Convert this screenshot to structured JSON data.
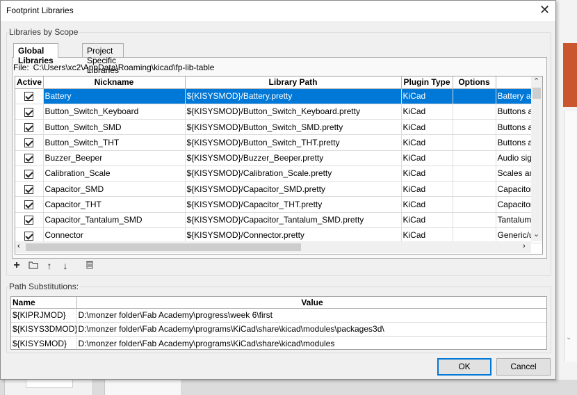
{
  "window": {
    "title": "Footprint Libraries",
    "close_glyph": "✕"
  },
  "scope_group": {
    "label": "Libraries by Scope",
    "tabs": [
      "Global Libraries",
      "Project Specific Libraries"
    ],
    "active_tab": "Global Libraries"
  },
  "file": {
    "label": "File:",
    "path": "C:\\Users\\xc2\\AppData\\Roaming\\kicad\\fp-lib-table"
  },
  "library_table": {
    "columns": [
      "Active",
      "Nickname",
      "Library Path",
      "Plugin Type",
      "Options",
      ""
    ],
    "selected_row": 0,
    "rows": [
      {
        "active": true,
        "nickname": "Battery",
        "path": "${KISYSMOD}/Battery.pretty",
        "plugin": "KiCad",
        "options": "",
        "description": "Battery ar"
      },
      {
        "active": true,
        "nickname": "Button_Switch_Keyboard",
        "path": "${KISYSMOD}/Button_Switch_Keyboard.pretty",
        "plugin": "KiCad",
        "options": "",
        "description": "Buttons a"
      },
      {
        "active": true,
        "nickname": "Button_Switch_SMD",
        "path": "${KISYSMOD}/Button_Switch_SMD.pretty",
        "plugin": "KiCad",
        "options": "",
        "description": "Buttons a"
      },
      {
        "active": true,
        "nickname": "Button_Switch_THT",
        "path": "${KISYSMOD}/Button_Switch_THT.pretty",
        "plugin": "KiCad",
        "options": "",
        "description": "Buttons a"
      },
      {
        "active": true,
        "nickname": "Buzzer_Beeper",
        "path": "${KISYSMOD}/Buzzer_Beeper.pretty",
        "plugin": "KiCad",
        "options": "",
        "description": "Audio sig"
      },
      {
        "active": true,
        "nickname": "Calibration_Scale",
        "path": "${KISYSMOD}/Calibration_Scale.pretty",
        "plugin": "KiCad",
        "options": "",
        "description": "Scales an"
      },
      {
        "active": true,
        "nickname": "Capacitor_SMD",
        "path": "${KISYSMOD}/Capacitor_SMD.pretty",
        "plugin": "KiCad",
        "options": "",
        "description": "Capacitor"
      },
      {
        "active": true,
        "nickname": "Capacitor_THT",
        "path": "${KISYSMOD}/Capacitor_THT.pretty",
        "plugin": "KiCad",
        "options": "",
        "description": "Capacitor"
      },
      {
        "active": true,
        "nickname": "Capacitor_Tantalum_SMD",
        "path": "${KISYSMOD}/Capacitor_Tantalum_SMD.pretty",
        "plugin": "KiCad",
        "options": "",
        "description": "Tantalum"
      },
      {
        "active": true,
        "nickname": "Connector",
        "path": "${KISYSMOD}/Connector.pretty",
        "plugin": "KiCad",
        "options": "",
        "description": "Generic/u"
      }
    ]
  },
  "toolbar": {
    "add_icon": "+",
    "folder_icon": "folder-icon",
    "up_icon": "↑",
    "down_icon": "↓",
    "delete_icon": "trash-icon"
  },
  "substitutions": {
    "label": "Path Substitutions:",
    "columns": [
      "Name",
      "Value"
    ],
    "rows": [
      {
        "name": "${KIPRJMOD}",
        "value": "D:\\monzer folder\\Fab Academy\\progress\\week 6\\first"
      },
      {
        "name": "${KISYS3DMOD}",
        "value": "D:\\monzer folder\\Fab Academy\\programs\\KiCad\\share\\kicad\\modules\\packages3d\\"
      },
      {
        "name": "${KISYSMOD}",
        "value": "D:\\monzer folder\\Fab Academy\\programs\\KiCad\\share\\kicad\\modules"
      }
    ]
  },
  "buttons": {
    "ok": "OK",
    "cancel": "Cancel"
  },
  "colors": {
    "selection": "#0078d7",
    "background_accent": "#c9562c"
  }
}
